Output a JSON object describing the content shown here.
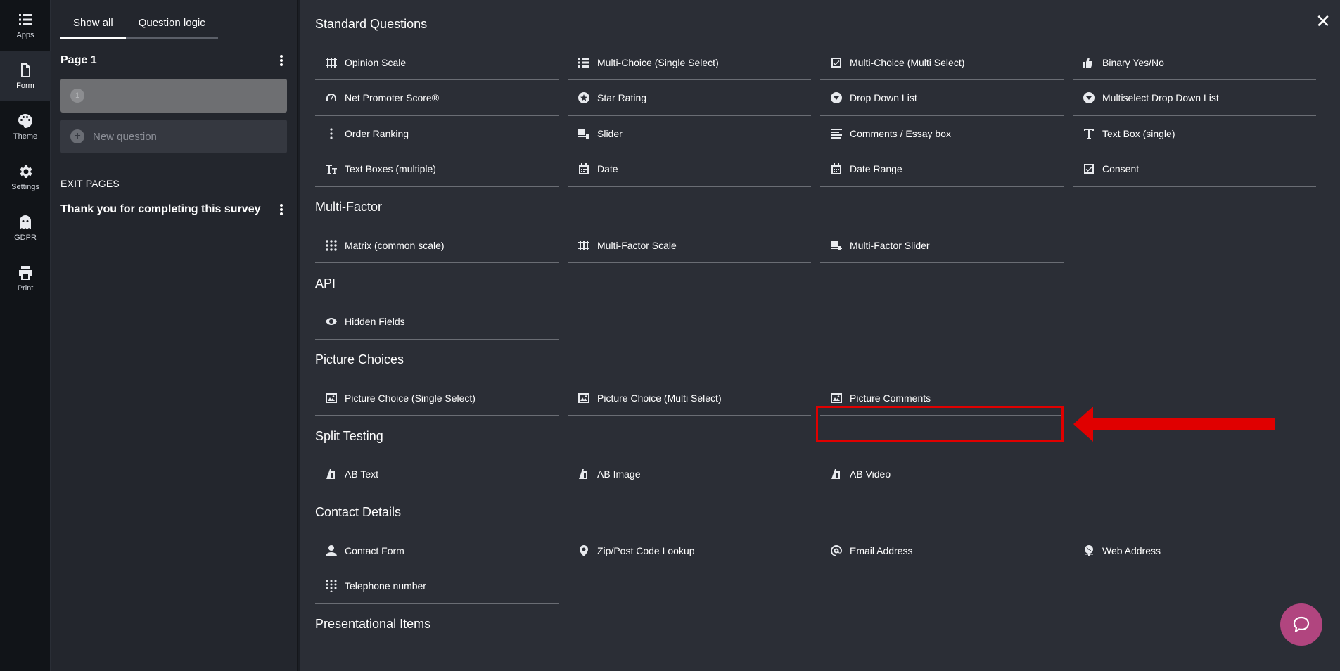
{
  "rail": [
    {
      "label": "Apps",
      "icon": "apps-icon",
      "active": false
    },
    {
      "label": "Form",
      "icon": "form-icon",
      "active": true
    },
    {
      "label": "Theme",
      "icon": "palette-icon",
      "active": false
    },
    {
      "label": "Settings",
      "icon": "gear-icon",
      "active": false
    },
    {
      "label": "GDPR",
      "icon": "ghost-icon",
      "active": false
    },
    {
      "label": "Print",
      "icon": "printer-icon",
      "active": false
    }
  ],
  "panel": {
    "tabs": [
      "Show all",
      "Question logic"
    ],
    "page_title": "Page 1",
    "question_number": "1",
    "new_question": "New question",
    "exit_heading": "EXIT PAGES",
    "exit_item": "Thank you for completing this survey"
  },
  "main": {
    "close": "✕",
    "sections": [
      {
        "title": "Standard Questions",
        "items": [
          {
            "label": "Opinion Scale",
            "icon": "scale-icon"
          },
          {
            "label": "Multi-Choice (Single Select)",
            "icon": "list-icon"
          },
          {
            "label": "Multi-Choice (Multi Select)",
            "icon": "checkbox-icon"
          },
          {
            "label": "Binary Yes/No",
            "icon": "thumbs-icon"
          },
          {
            "label": "Net Promoter Score®",
            "icon": "gauge-icon"
          },
          {
            "label": "Star Rating",
            "icon": "star-icon"
          },
          {
            "label": "Drop Down List",
            "icon": "dropdown-icon"
          },
          {
            "label": "Multiselect Drop Down List",
            "icon": "dropdown-icon"
          },
          {
            "label": "Order Ranking",
            "icon": "ranking-icon"
          },
          {
            "label": "Slider",
            "icon": "slider-icon"
          },
          {
            "label": "Comments / Essay box",
            "icon": "lines-icon"
          },
          {
            "label": "Text Box (single)",
            "icon": "text-icon"
          },
          {
            "label": "Text Boxes (multiple)",
            "icon": "text-multi-icon"
          },
          {
            "label": "Date",
            "icon": "calendar-icon"
          },
          {
            "label": "Date Range",
            "icon": "calendar-icon"
          },
          {
            "label": "Consent",
            "icon": "checkbox-icon"
          }
        ]
      },
      {
        "title": "Multi-Factor",
        "items": [
          {
            "label": "Matrix (common scale)",
            "icon": "grid-icon"
          },
          {
            "label": "Multi-Factor Scale",
            "icon": "scale-icon"
          },
          {
            "label": "Multi-Factor Slider",
            "icon": "slider-icon"
          }
        ]
      },
      {
        "title": "API",
        "items": [
          {
            "label": "Hidden Fields",
            "icon": "eye-icon"
          }
        ]
      },
      {
        "title": "Picture Choices",
        "items": [
          {
            "label": "Picture Choice (Single Select)",
            "icon": "picture-icon"
          },
          {
            "label": "Picture Choice (Multi Select)",
            "icon": "picture-icon"
          },
          {
            "label": "Picture Comments",
            "icon": "picture-icon"
          }
        ]
      },
      {
        "title": "Split Testing",
        "items": [
          {
            "label": "AB Text",
            "icon": "ab-icon"
          },
          {
            "label": "AB Image",
            "icon": "ab-icon"
          },
          {
            "label": "AB Video",
            "icon": "ab-icon"
          }
        ]
      },
      {
        "title": "Contact Details",
        "items": [
          {
            "label": "Contact Form",
            "icon": "person-icon"
          },
          {
            "label": "Zip/Post Code Lookup",
            "icon": "pin-icon"
          },
          {
            "label": "Email Address",
            "icon": "at-icon"
          },
          {
            "label": "Web Address",
            "icon": "globe-icon"
          },
          {
            "label": "Telephone number",
            "icon": "dialpad-icon"
          }
        ]
      },
      {
        "title": "Presentational Items",
        "items": []
      }
    ]
  },
  "colors": {
    "highlight": "#e00000",
    "help_button": "#b1457f",
    "main_bg": "#2b2e36"
  }
}
